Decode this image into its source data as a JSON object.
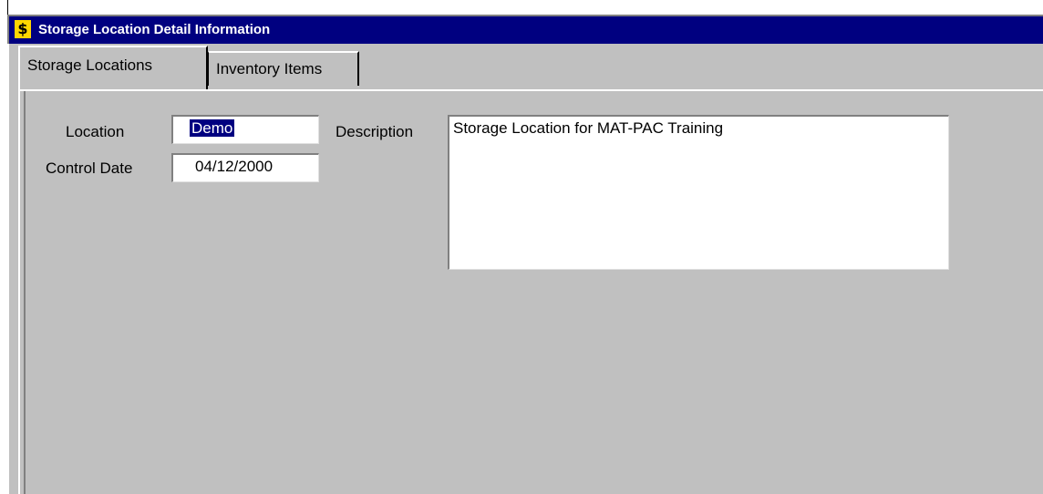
{
  "window": {
    "title": "Storage Location Detail Information",
    "icon": "dollar-sign-icon",
    "icon_glyph": "$"
  },
  "tabs": [
    {
      "label": "Storage Locations",
      "active": true
    },
    {
      "label": "Inventory Items",
      "active": false
    }
  ],
  "form": {
    "location_label": "Location",
    "location_value": "Demo",
    "control_date_label": "Control Date",
    "control_date_value": "04/12/2000",
    "description_label": "Description",
    "description_value": "Storage Location for MAT-PAC Training"
  },
  "colors": {
    "titlebar": "#000080",
    "face": "#c0c0c0",
    "selection": "#000080",
    "icon": "#ffd700"
  }
}
